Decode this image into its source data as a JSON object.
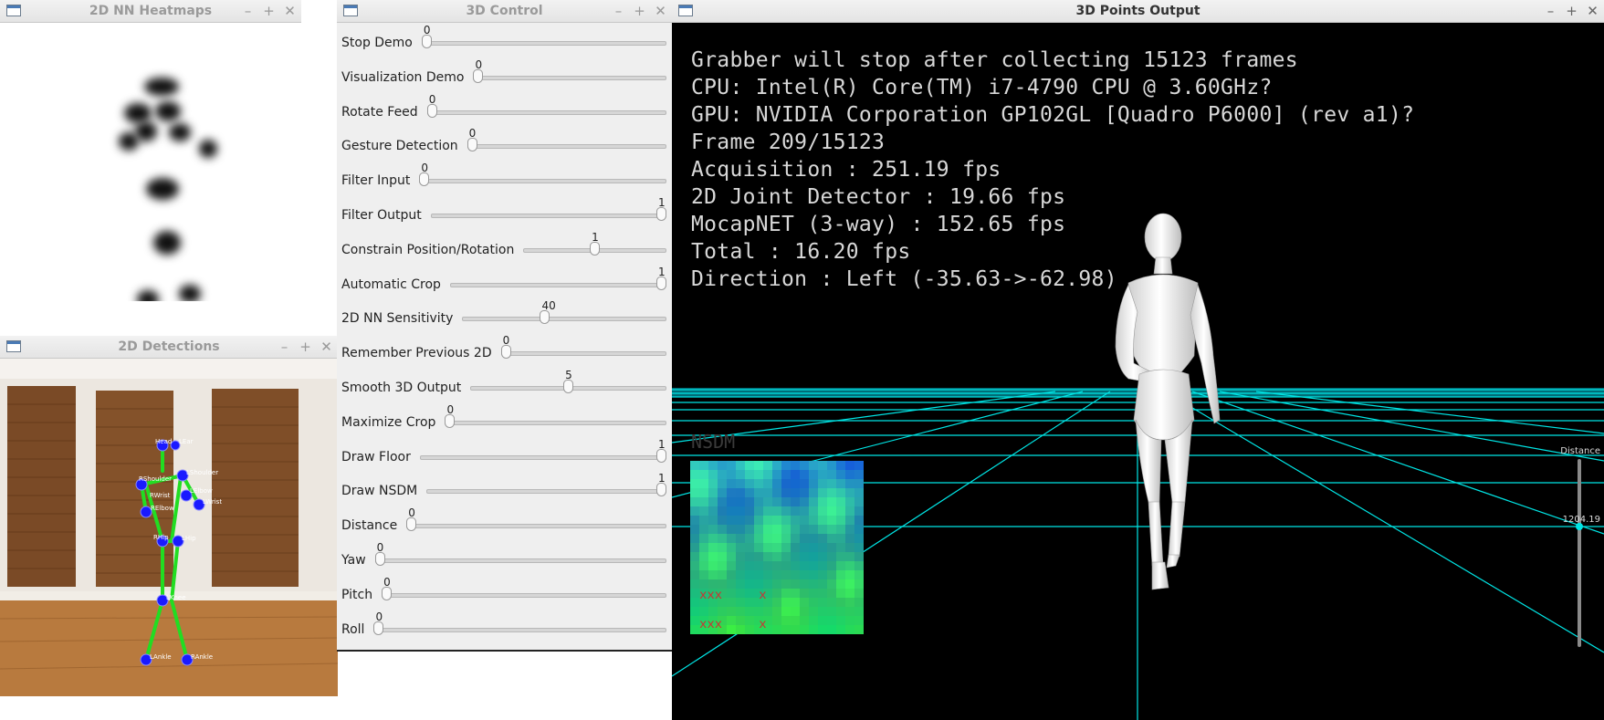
{
  "windows": {
    "heatmaps": {
      "title": "2D NN Heatmaps"
    },
    "detections": {
      "title": "2D Detections"
    },
    "control": {
      "title": "3D Control"
    },
    "output": {
      "title": "3D Points Output"
    }
  },
  "window_controls": {
    "minimize": "–",
    "maximize": "+",
    "close": "✕"
  },
  "sliders": [
    {
      "label": "Stop Demo",
      "value": "0",
      "fraction": 0.0
    },
    {
      "label": "Visualization Demo",
      "value": "0",
      "fraction": 0.0
    },
    {
      "label": "Rotate Feed",
      "value": "0",
      "fraction": 0.0
    },
    {
      "label": "Gesture Detection",
      "value": "0",
      "fraction": 0.0
    },
    {
      "label": "Filter Input",
      "value": "0",
      "fraction": 0.0
    },
    {
      "label": "Filter Output",
      "value": "1",
      "fraction": 1.0
    },
    {
      "label": "Constrain Position/Rotation",
      "value": "1",
      "fraction": 0.5
    },
    {
      "label": "Automatic Crop",
      "value": "1",
      "fraction": 1.0
    },
    {
      "label": "2D NN Sensitivity",
      "value": "40",
      "fraction": 0.4
    },
    {
      "label": "Remember Previous 2D",
      "value": "0",
      "fraction": 0.0
    },
    {
      "label": "Smooth 3D Output",
      "value": "5",
      "fraction": 0.5
    },
    {
      "label": "Maximize Crop",
      "value": "0",
      "fraction": 0.0
    },
    {
      "label": "Draw Floor",
      "value": "1",
      "fraction": 1.0
    },
    {
      "label": "Draw NSDM",
      "value": "1",
      "fraction": 1.0
    },
    {
      "label": "Distance",
      "value": "0",
      "fraction": 0.0
    },
    {
      "label": "Yaw",
      "value": "0",
      "fraction": 0.0
    },
    {
      "label": "Pitch",
      "value": "0",
      "fraction": 0.0
    },
    {
      "label": "Roll",
      "value": "0",
      "fraction": 0.0
    }
  ],
  "output": {
    "lines": [
      "Grabber will stop after collecting  15123 frames",
      "CPU: Intel(R) Core(TM) i7-4790 CPU @ 3.60GHz?",
      "GPU: NVIDIA Corporation GP102GL [Quadro P6000] (rev a1)?",
      "Frame 209/15123",
      "Acquisition : 251.19 fps",
      "2D Joint Detector : 19.66 fps",
      "MocapNET (3-way) : 152.65 fps",
      "Total : 16.20 fps",
      "Direction : Left (-35.63->-62.98)"
    ],
    "nsdm_label": "NSDM",
    "distance_label": "Distance",
    "distance_value": "1204.19",
    "grid_color": "#00e5e5",
    "nsdm_marks": [
      "xxx",
      "x",
      "xxx",
      "x"
    ]
  },
  "detections": {
    "joint_labels": [
      "Head",
      "LEar",
      "LShoulder",
      "RShoulder",
      "LElbow",
      "RElbow",
      "LWrist",
      "RWrist",
      "LHip",
      "RHip",
      "LKnee",
      "LAnkle",
      "RAnkle"
    ]
  },
  "colors": {
    "skeleton": "#22dd22",
    "joint": "#1a1aff",
    "grid": "#00e5e5",
    "background": "#000000"
  }
}
